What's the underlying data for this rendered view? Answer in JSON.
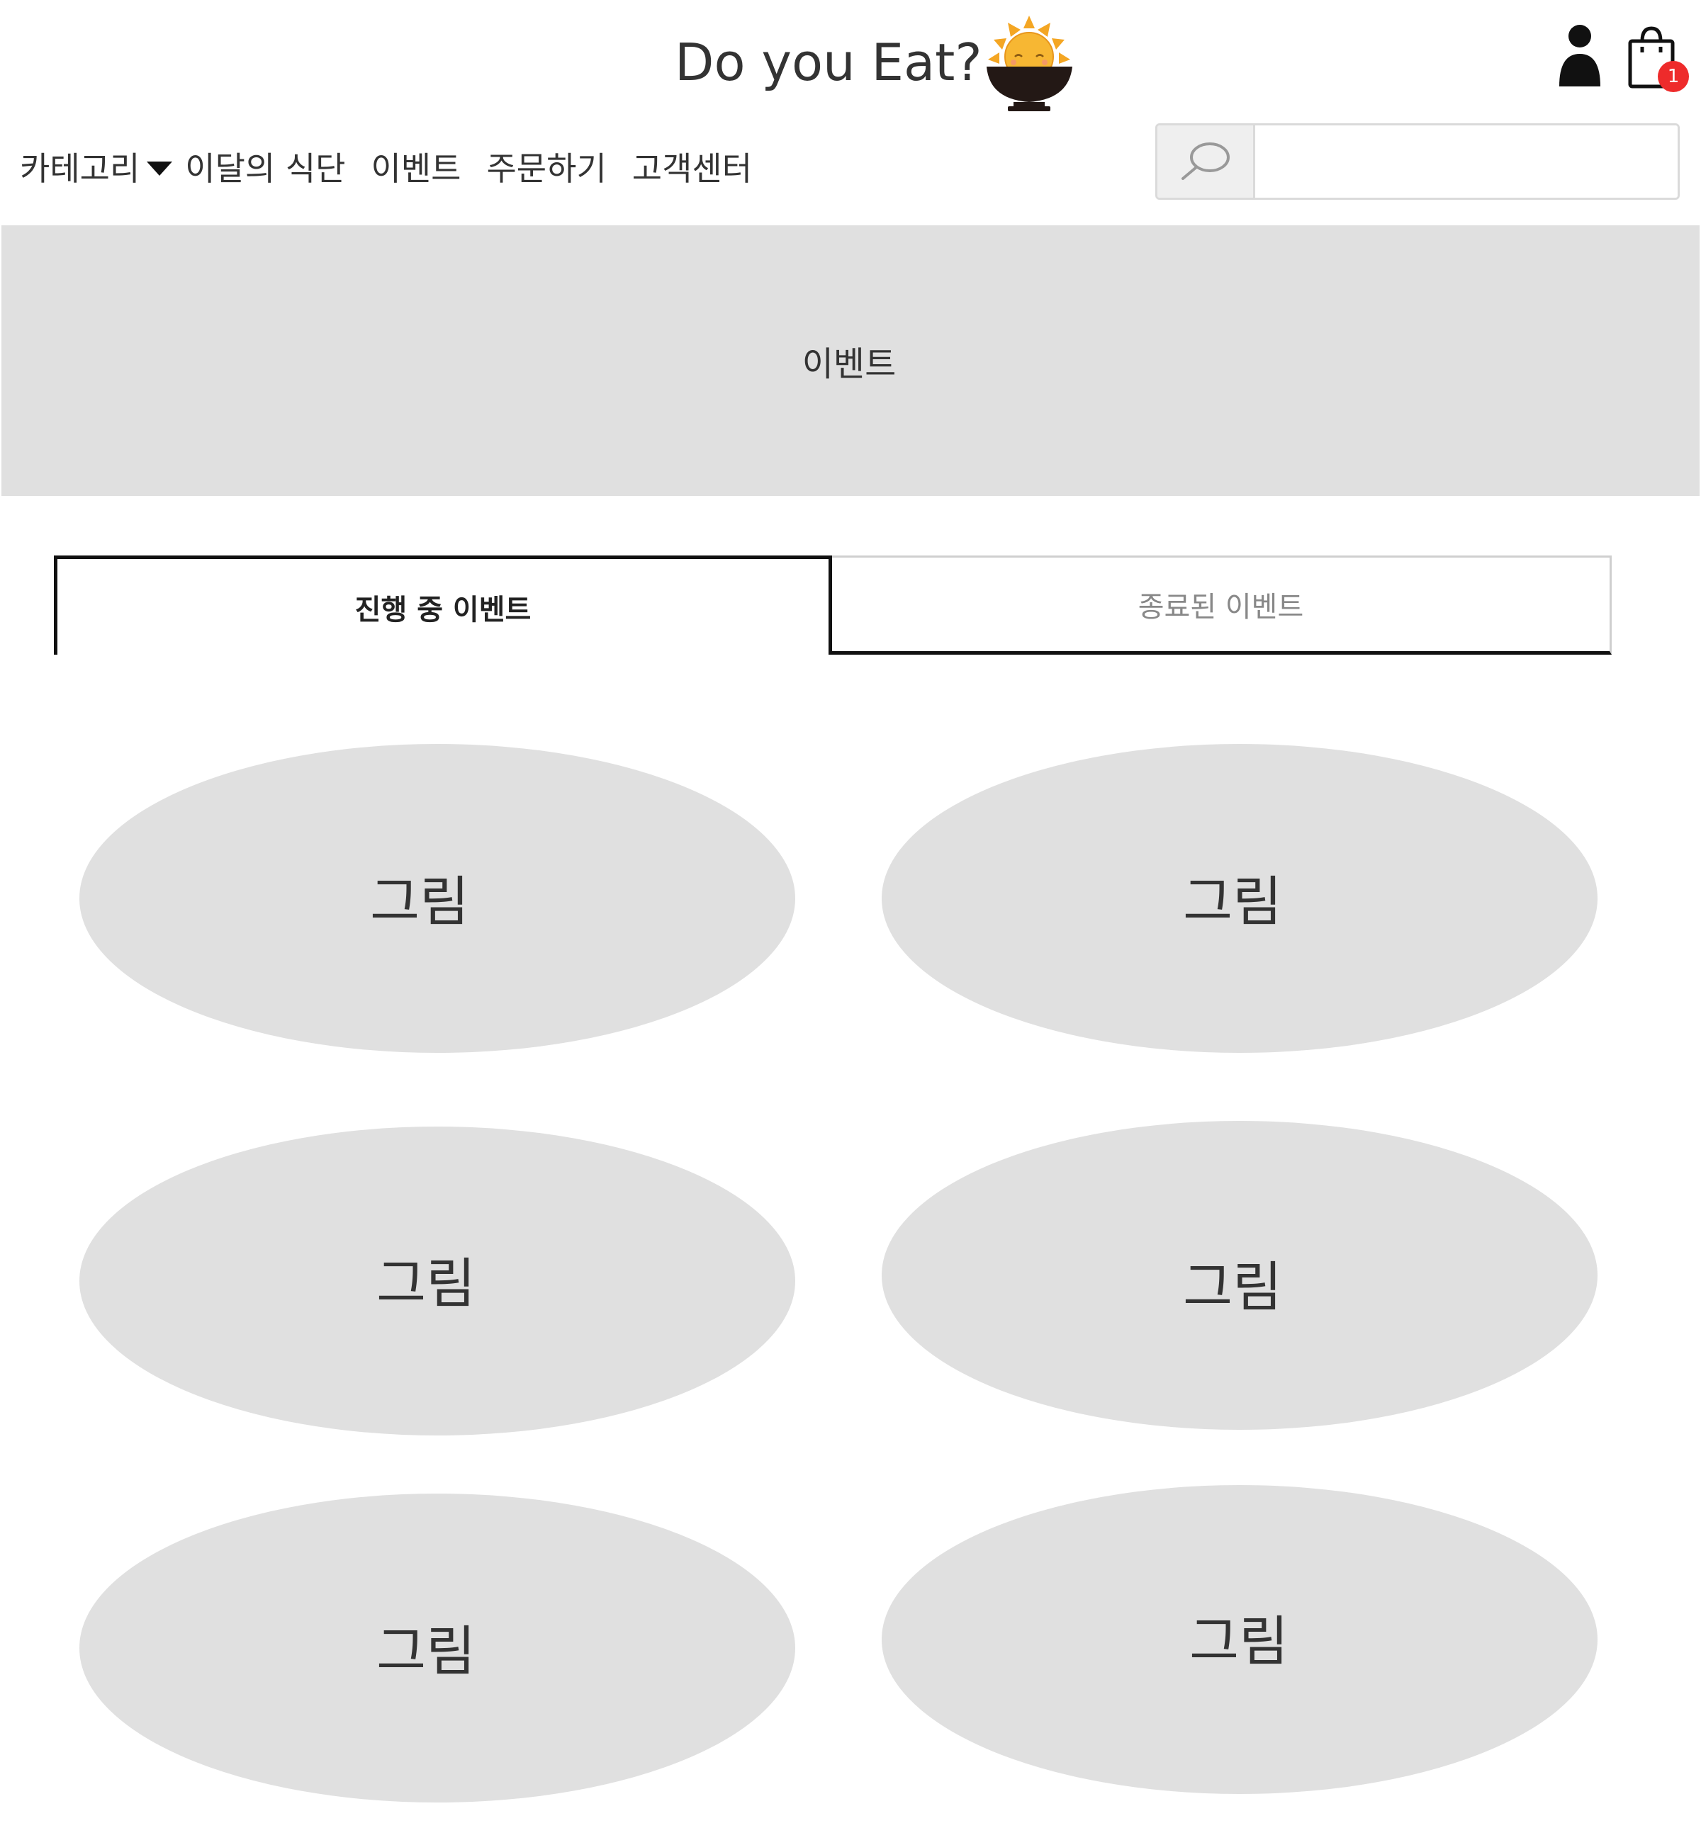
{
  "header": {
    "site_title": "Do you Eat?",
    "logo_icon": "sun-in-bowl-icon",
    "user_icon": "user-icon",
    "cart_icon": "shopping-bag-icon",
    "cart_count": "1",
    "badge_color": "#ee2b2b"
  },
  "nav": {
    "items": [
      {
        "label": "카테고리",
        "has_dropdown": true
      },
      {
        "label": "이달의 식단"
      },
      {
        "label": "이벤트"
      },
      {
        "label": "주문하기"
      },
      {
        "label": "고객센터"
      }
    ]
  },
  "search": {
    "icon": "search-icon",
    "value": "",
    "placeholder": ""
  },
  "banner": {
    "title": "이벤트"
  },
  "tabs": [
    {
      "label": "진행 중 이벤트",
      "active": true
    },
    {
      "label": "종료된 이벤트",
      "active": false
    }
  ],
  "cards": [
    {
      "label": "그림"
    },
    {
      "label": "그림"
    },
    {
      "label": "그림"
    },
    {
      "label": "그림"
    },
    {
      "label": "그림"
    },
    {
      "label": "그림"
    }
  ]
}
